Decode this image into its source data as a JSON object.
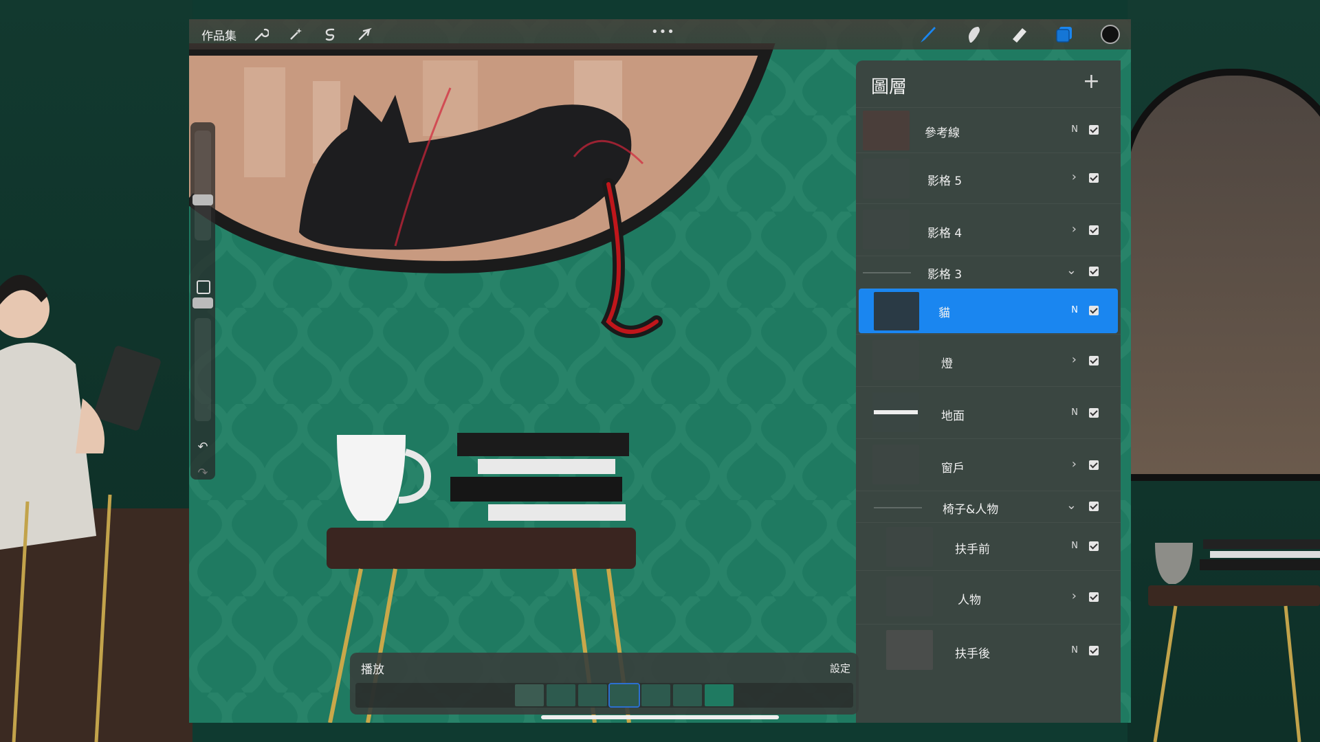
{
  "toolbar": {
    "gallery_label": "作品集",
    "left_tools": [
      "wrench-icon",
      "magic-wand-icon",
      "selection-icon",
      "transform-arrow-icon"
    ],
    "right_tools": [
      "brush-icon",
      "smudge-icon",
      "eraser-icon",
      "layers-icon",
      "color-icon"
    ],
    "accent": "#1a86f0",
    "color_swatch": "#111111"
  },
  "layers_panel": {
    "title": "圖層",
    "add_label": "+",
    "rows": [
      {
        "name": "參考線",
        "mode": "N",
        "kind": "layer",
        "visible": true
      },
      {
        "name": "影格 5",
        "mode": ">",
        "kind": "group",
        "visible": true
      },
      {
        "name": "影格 4",
        "mode": ">",
        "kind": "group",
        "visible": true
      },
      {
        "name": "影格 3",
        "mode": "v",
        "kind": "group-open",
        "visible": true
      },
      {
        "name": "貓",
        "mode": "N",
        "kind": "layer",
        "visible": true,
        "selected": true
      },
      {
        "name": "燈",
        "mode": ">",
        "kind": "group",
        "visible": true
      },
      {
        "name": "地面",
        "mode": "N",
        "kind": "layer",
        "visible": true
      },
      {
        "name": "窗戶",
        "mode": ">",
        "kind": "group",
        "visible": true
      },
      {
        "name": "椅子&人物",
        "mode": "v",
        "kind": "group-open",
        "visible": true
      },
      {
        "name": "扶手前",
        "mode": "N",
        "kind": "layer",
        "visible": true
      },
      {
        "name": "人物",
        "mode": ">",
        "kind": "group",
        "visible": true
      },
      {
        "name": "扶手後",
        "mode": "N",
        "kind": "layer",
        "visible": true
      }
    ]
  },
  "playback": {
    "label": "播放",
    "settings_label": "設定",
    "frame_count": 7
  }
}
